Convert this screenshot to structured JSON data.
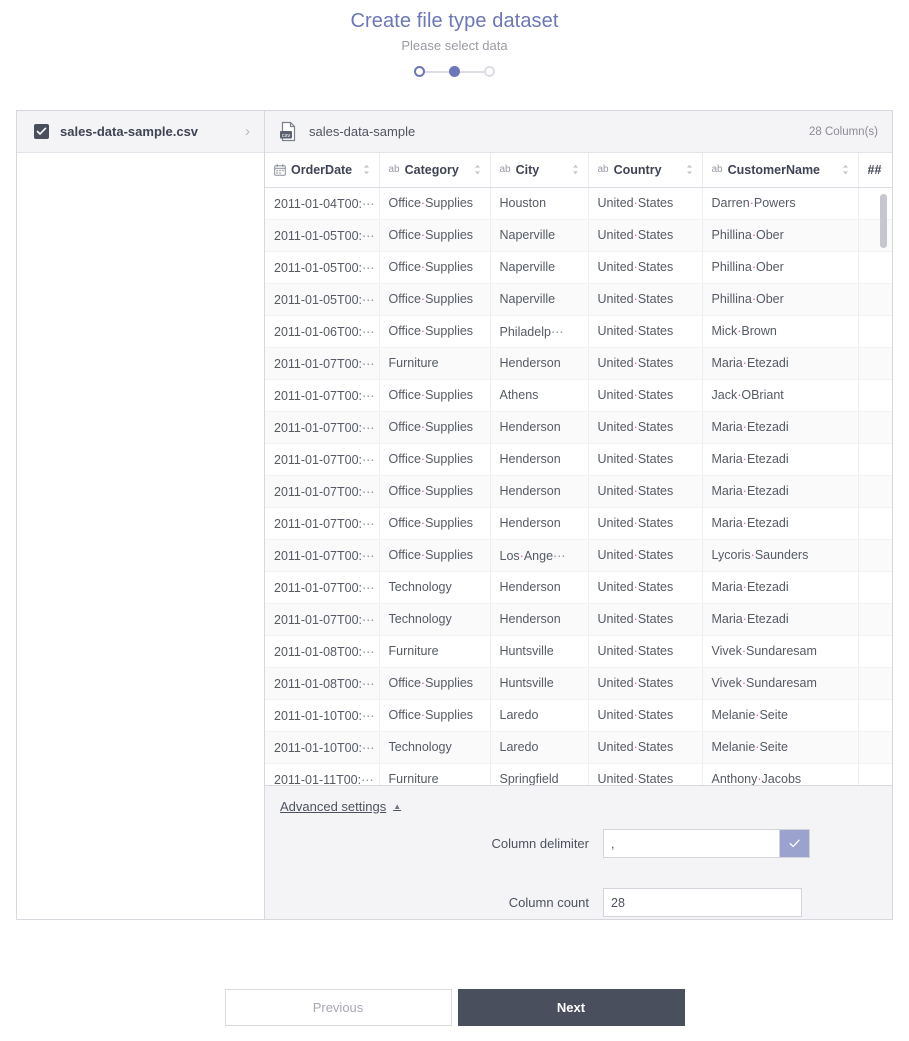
{
  "header": {
    "title": "Create file type dataset",
    "subtitle": "Please select data",
    "steps": [
      {
        "name": "step-1",
        "state": "completed"
      },
      {
        "name": "step-2",
        "state": "active"
      },
      {
        "name": "step-3",
        "state": "inactive"
      }
    ]
  },
  "sidebar": {
    "files": [
      {
        "name": "sales-data-sample.csv",
        "checked": true
      }
    ]
  },
  "preview": {
    "file_title": "sales-data-sample",
    "file_icon_label": "csv",
    "column_count_label": "28 Column(s)",
    "columns": [
      {
        "label": "OrderDate",
        "type_icon": "calendar",
        "sortable": true
      },
      {
        "label": "Category",
        "type_icon": "ab",
        "sortable": true
      },
      {
        "label": "City",
        "type_icon": "ab",
        "sortable": true
      },
      {
        "label": "Country",
        "type_icon": "ab",
        "sortable": true
      },
      {
        "label": "CustomerName",
        "type_icon": "ab",
        "sortable": true
      },
      {
        "label": "##",
        "type_icon": "number",
        "sortable": false
      }
    ],
    "rows": [
      {
        "date": "2011-01-04T00:",
        "category": "Office Supplies",
        "city": "Houston",
        "country": "United States",
        "customer": "Darren Powers"
      },
      {
        "date": "2011-01-05T00:",
        "category": "Office Supplies",
        "city": "Naperville",
        "country": "United States",
        "customer": "Phillina Ober"
      },
      {
        "date": "2011-01-05T00:",
        "category": "Office Supplies",
        "city": "Naperville",
        "country": "United States",
        "customer": "Phillina Ober"
      },
      {
        "date": "2011-01-05T00:",
        "category": "Office Supplies",
        "city": "Naperville",
        "country": "United States",
        "customer": "Phillina Ober"
      },
      {
        "date": "2011-01-06T00:",
        "category": "Office Supplies",
        "city": "Philadelp",
        "city_truncated": true,
        "country": "United States",
        "customer": "Mick Brown"
      },
      {
        "date": "2011-01-07T00:",
        "category": "Furniture",
        "city": "Henderson",
        "country": "United States",
        "customer": "Maria Etezadi"
      },
      {
        "date": "2011-01-07T00:",
        "category": "Office Supplies",
        "city": "Athens",
        "country": "United States",
        "customer": "Jack OBriant"
      },
      {
        "date": "2011-01-07T00:",
        "category": "Office Supplies",
        "city": "Henderson",
        "country": "United States",
        "customer": "Maria Etezadi"
      },
      {
        "date": "2011-01-07T00:",
        "category": "Office Supplies",
        "city": "Henderson",
        "country": "United States",
        "customer": "Maria Etezadi"
      },
      {
        "date": "2011-01-07T00:",
        "category": "Office Supplies",
        "city": "Henderson",
        "country": "United States",
        "customer": "Maria Etezadi"
      },
      {
        "date": "2011-01-07T00:",
        "category": "Office Supplies",
        "city": "Henderson",
        "country": "United States",
        "customer": "Maria Etezadi"
      },
      {
        "date": "2011-01-07T00:",
        "category": "Office Supplies",
        "city": "Los Ange",
        "city_truncated": true,
        "country": "United States",
        "customer": "Lycoris Saunders"
      },
      {
        "date": "2011-01-07T00:",
        "category": "Technology",
        "city": "Henderson",
        "country": "United States",
        "customer": "Maria Etezadi"
      },
      {
        "date": "2011-01-07T00:",
        "category": "Technology",
        "city": "Henderson",
        "country": "United States",
        "customer": "Maria Etezadi"
      },
      {
        "date": "2011-01-08T00:",
        "category": "Furniture",
        "city": "Huntsville",
        "country": "United States",
        "customer": "Vivek Sundaresam"
      },
      {
        "date": "2011-01-08T00:",
        "category": "Office Supplies",
        "city": "Huntsville",
        "country": "United States",
        "customer": "Vivek Sundaresam"
      },
      {
        "date": "2011-01-10T00:",
        "category": "Office Supplies",
        "city": "Laredo",
        "country": "United States",
        "customer": "Melanie Seite"
      },
      {
        "date": "2011-01-10T00:",
        "category": "Technology",
        "city": "Laredo",
        "country": "United States",
        "customer": "Melanie Seite"
      },
      {
        "date": "2011-01-11T00:",
        "category": "Furniture",
        "city": "Springfield",
        "country": "United States",
        "customer": "Anthony Jacobs"
      }
    ]
  },
  "advanced": {
    "toggle_label": "Advanced settings",
    "expanded": true,
    "delimiter_label": "Column delimiter",
    "delimiter_value": ",",
    "column_count_label": "Column count",
    "column_count_value": "28"
  },
  "footer": {
    "previous_label": "Previous",
    "next_label": "Next"
  },
  "colors": {
    "accent": "#6b77b8",
    "dark": "#4a4f5e",
    "space_marker": "#ef4aa4",
    "button_ok": "#9ba2ce"
  }
}
